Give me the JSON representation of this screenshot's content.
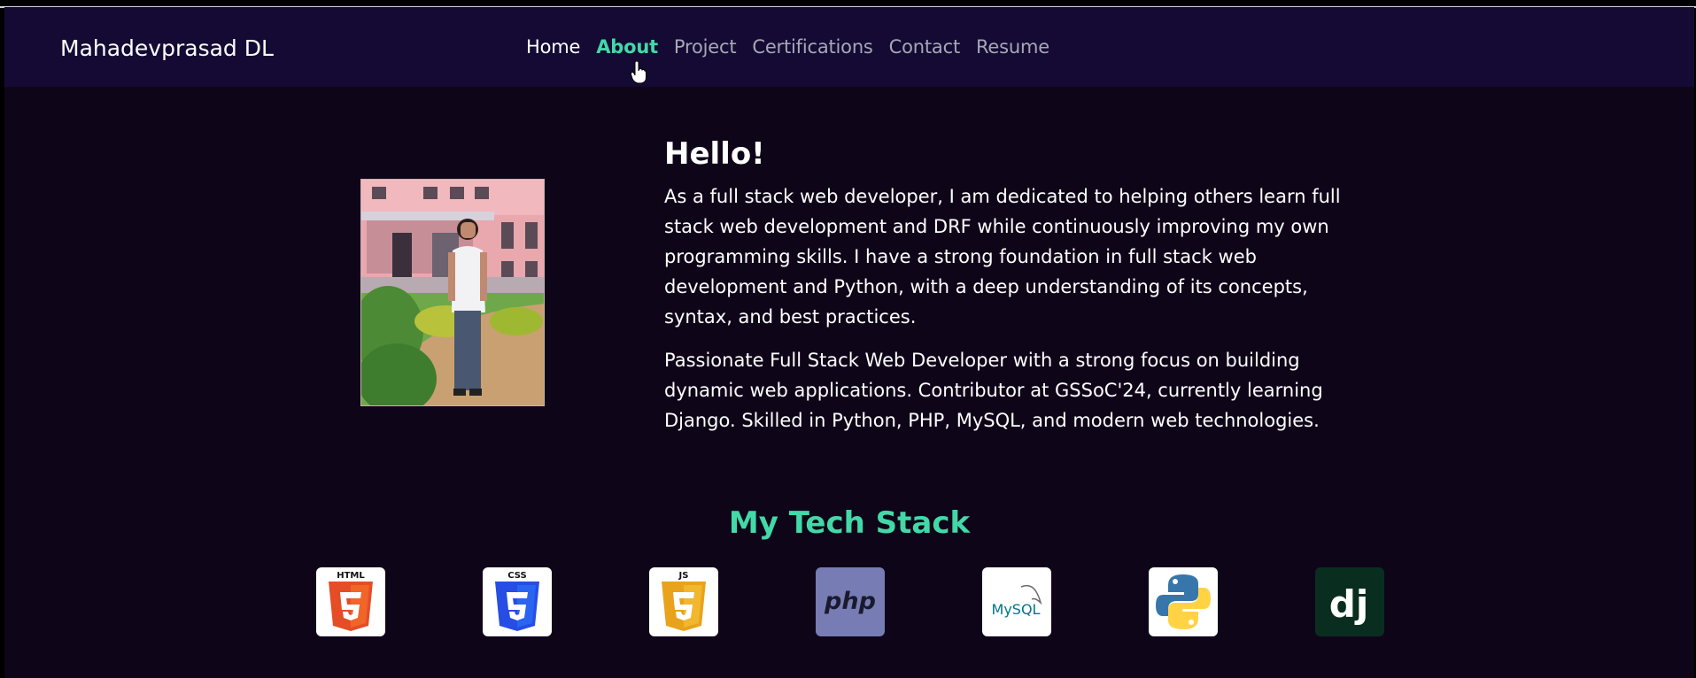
{
  "brand": "Mahadevprasad DL",
  "nav": {
    "home": "Home",
    "about": "About",
    "project": "Project",
    "certifications": "Certifications",
    "contact": "Contact",
    "resume": "Resume"
  },
  "about": {
    "heading": "Hello!",
    "paragraph1": "As a full stack web developer, I am dedicated to helping others learn full stack web development and DRF while continuously improving my own programming skills. I have a strong foundation in full stack web development and Python, with a deep understanding of its concepts, syntax, and best practices.",
    "paragraph2": "Passionate Full Stack Web Developer with a strong focus on building dynamic web applications. Contributor at GSSoC'24, currently learning Django. Skilled in Python, PHP, MySQL, and modern web technologies."
  },
  "tech_stack": {
    "title": "My Tech Stack",
    "items": [
      {
        "name": "html5",
        "logo_text": "HTML",
        "color": "#e44d26"
      },
      {
        "name": "css3",
        "logo_text": "CSS",
        "color": "#264de4"
      },
      {
        "name": "javascript",
        "logo_text": "JS",
        "color": "#e8a21b"
      },
      {
        "name": "php",
        "logo_text": "php",
        "color": "#787cb4"
      },
      {
        "name": "mysql",
        "logo_text": "MySQL",
        "color": "#00758f"
      },
      {
        "name": "python",
        "logo_text": "",
        "color": "#3776ab"
      },
      {
        "name": "django",
        "logo_text": "dj",
        "color": "#092e20"
      }
    ]
  },
  "colors": {
    "accent": "#42d9a7",
    "navbar": "#150a34",
    "background": "#0f0519"
  }
}
